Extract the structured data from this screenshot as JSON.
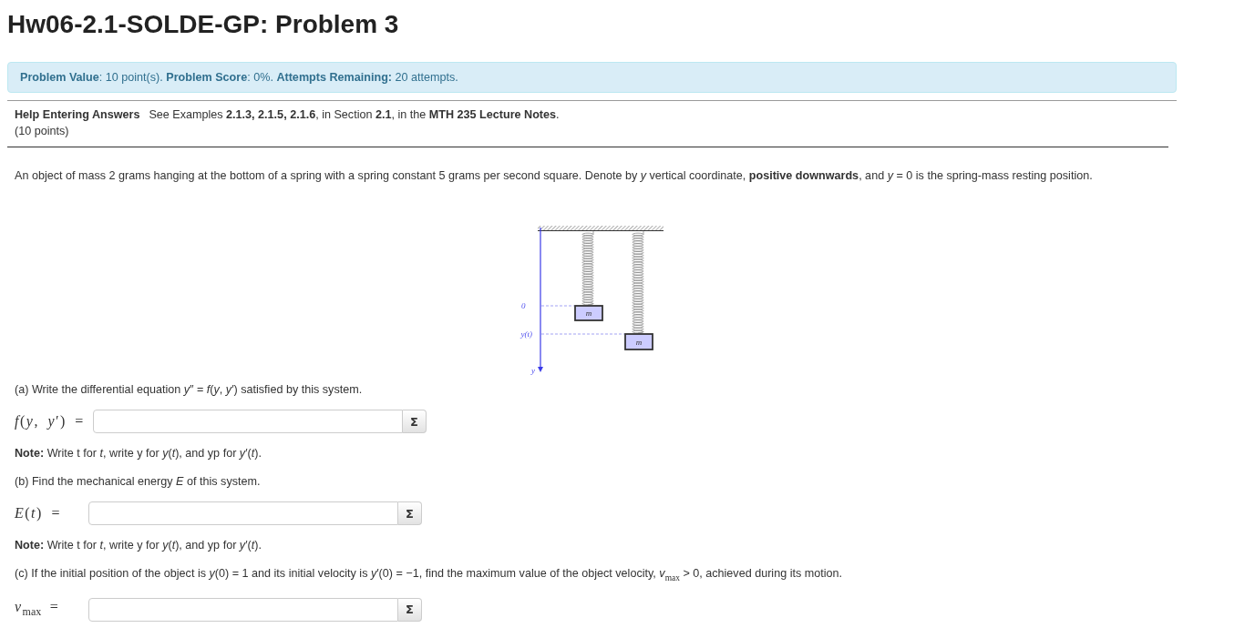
{
  "title": "Hw06-2.1-SOLDE-GP: Problem 3",
  "info_bar": {
    "text": "**Problem Value**: 10 point(s). **Problem Score**: 0%. **Attempts Remaining:** 20 attempts."
  },
  "help": {
    "link": "Help Entering Answers",
    "text": "See Examples **2.1.3, 2.1.5, 2.1.6**, in Section **2.1**, in the **MTH 235 Lecture Notes**.",
    "points": "(10 points)"
  },
  "statement": "An object of mass 2 grams hanging at the bottom of a spring with a spring constant 5 grams per second square. Denote by *y* vertical coordinate, **positive downwards**, and *y* = 0 is the spring-mass resting position.",
  "figure": {
    "axis_labels": [
      "0",
      "y(t)",
      "y"
    ],
    "mass_labels": [
      "m",
      "m"
    ]
  },
  "parts": [
    {
      "kind": "question",
      "text": "(a) Write the differential equation *y*″ = *f*(*y*, *y*′) satisfied by this system."
    },
    {
      "kind": "answer",
      "label": "*f*(*y*, *y*′) =",
      "button": "Σ"
    },
    {
      "kind": "note",
      "text": "**Note:** Write t for *t*, write y for *y*(*t*), and yp for *y*′(*t*)."
    },
    {
      "kind": "question",
      "text": "(b) Find the mechanical energy *E* of this system."
    },
    {
      "kind": "answer",
      "label": "*E*(*t*) =",
      "button": "Σ"
    },
    {
      "kind": "note",
      "text": "**Note:** Write t for *t*, write y for *y*(*t*), and yp for *y*′(*t*)."
    },
    {
      "kind": "question",
      "text": "(c) If the initial position of the object is *y*(0) = 1 and its initial velocity is *y*′(0) = −1, find the maximum value of the object velocity, *v*$_{max}$ > 0, achieved during its motion."
    },
    {
      "kind": "answer",
      "label": "*v*$_{max}$ =",
      "button": "Σ"
    }
  ]
}
